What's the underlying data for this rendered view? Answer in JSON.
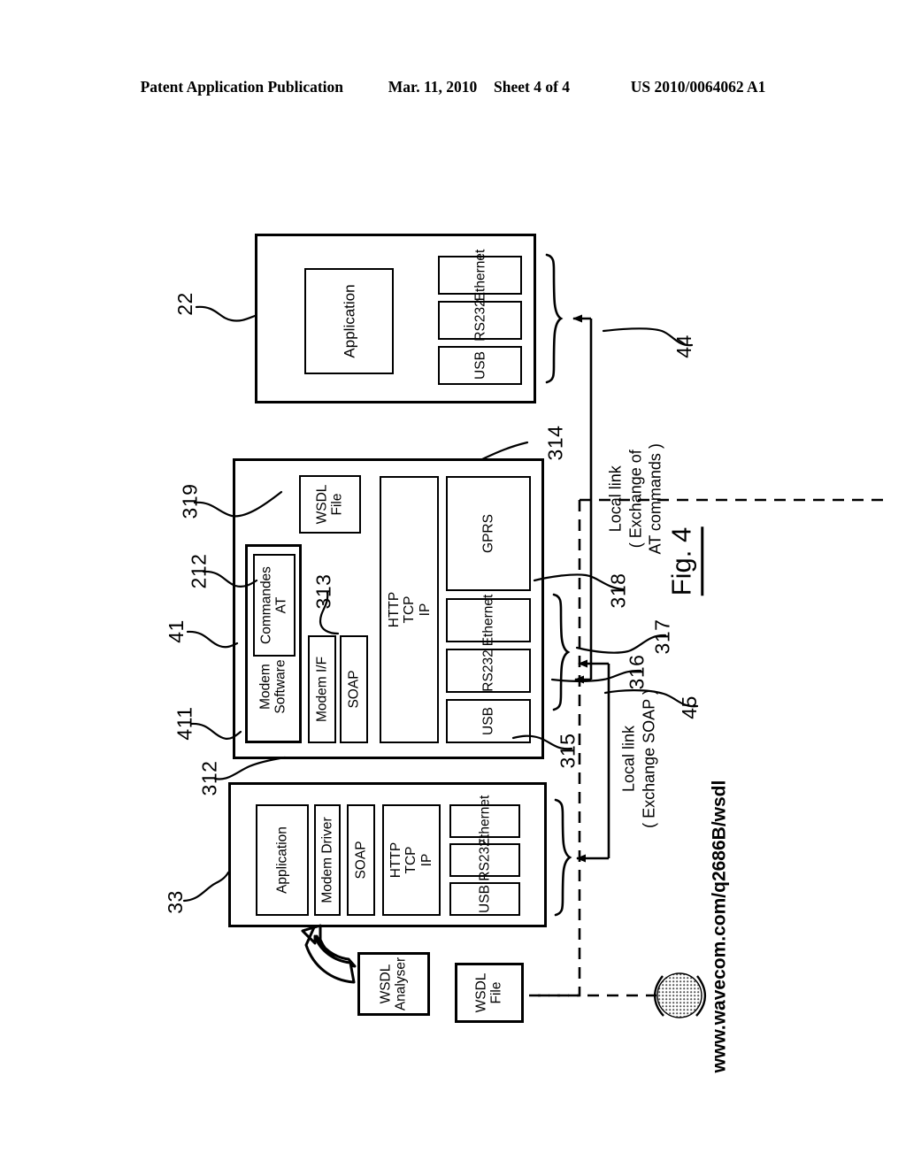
{
  "header": {
    "publication": "Patent Application Publication",
    "date": "Mar. 11, 2010",
    "sheet": "Sheet 4 of 4",
    "number": "US 2010/0064062 A1"
  },
  "figure": {
    "caption": "Fig. 4",
    "url": "www.wavecom.com/q2686B/wsdl"
  },
  "blocks": {
    "remote_terminal": {
      "ref": "22",
      "application": "Application",
      "ports": [
        "Ethernet",
        "RS232",
        "USB"
      ]
    },
    "modem": {
      "refs": {
        "wsdl_file": "319",
        "commandes_at": "212",
        "modem_software_inner": "41",
        "modem_software": "411",
        "modem_if": "312",
        "soap": "313",
        "stack": "314",
        "usb": "315",
        "rs232": "316",
        "ethernet": "317",
        "gprs": "318"
      },
      "wsdl_file": "WSDL\nFile",
      "modem_software": "Modem\nSoftware",
      "commandes_at": "Commandes\nAT",
      "modem_if": "Modem I/F",
      "soap": "SOAP",
      "stack": "HTTP\nTCP\nIP",
      "gprs": "GPRS",
      "ethernet": "Ethernet",
      "rs232": "RS232",
      "usb": "USB"
    },
    "host": {
      "ref": "33",
      "application": "Application",
      "modem_driver": "Modem Driver",
      "soap": "SOAP",
      "stack": "HTTP\nTCP\nIP",
      "ethernet": "Ethernet",
      "rs232": "RS232",
      "usb": "USB"
    },
    "wsdl_analyser": "WSDL\nAnalyser",
    "wsdl_file_ext": "WSDL\nFile"
  },
  "links": {
    "at_commands": {
      "ref": "44",
      "line1": "Local link",
      "line2": "( Exchange of",
      "line3": "AT commands )"
    },
    "soap": {
      "ref": "45",
      "line1": "Local link",
      "line2": "( Exchange SOAP )"
    }
  },
  "colors": {
    "ink": "#000000",
    "paper": "#ffffff"
  }
}
